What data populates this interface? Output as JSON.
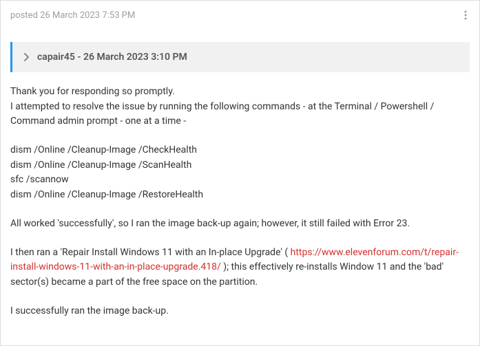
{
  "header": {
    "posted_label": "posted",
    "posted_date": "26 March 2023 7:53 PM"
  },
  "quote": {
    "author": "capair45",
    "separator": " - ",
    "date": "26 March 2023 3:10 PM"
  },
  "body": {
    "thank_you": "Thank you for responding so promptly.",
    "attempt_intro": "I attempted to resolve the issue by running the following commands - at the Terminal / Powershell / Command admin prompt - one at a time -",
    "cmd1": "dism /Online /Cleanup-Image /CheckHealth",
    "cmd2": "dism /Online /Cleanup-Image /ScanHealth",
    "cmd3": "sfc /scannow",
    "cmd4": "dism /Online /Cleanup-Image /RestoreHealth",
    "result1": "All worked 'successfully', so I ran the image back-up again; however, it still failed with Error 23.",
    "repair_prefix": "I then ran a 'Repair Install Windows 11 with an In-place Upgrade' ( ",
    "repair_link": "https://www.elevenforum.com/t/repair-install-windows-11-with-an-in-place-upgrade.418/",
    "repair_suffix": " ); this effectively re-installs Window 11 and the 'bad' sector(s) became a part of the free space on the partition.",
    "success": "I successfully ran the image back-up."
  }
}
